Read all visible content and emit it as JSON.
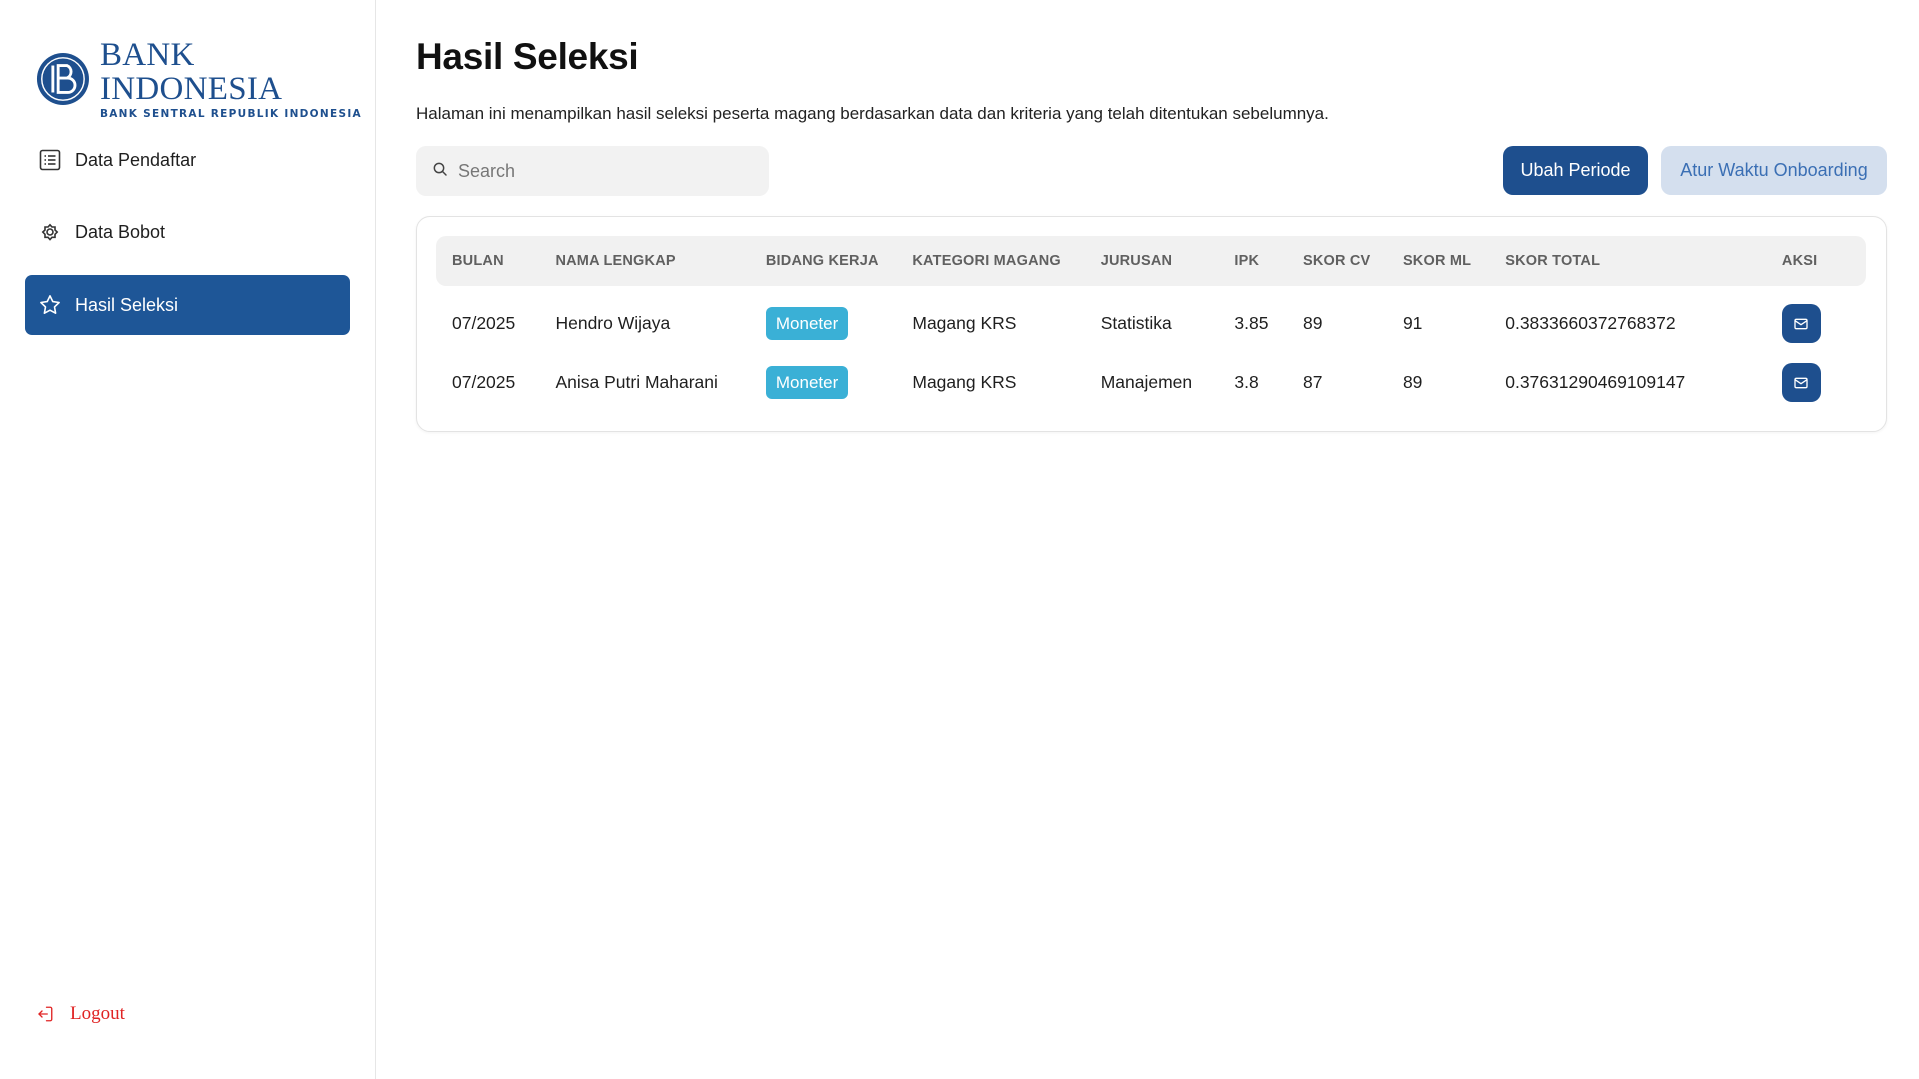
{
  "brand": {
    "title": "BANK INDONESIA",
    "subtitle": "BANK SENTRAL REPUBLIK INDONESIA",
    "color": "#1e4f8e"
  },
  "sidebar": {
    "items": [
      {
        "label": "Data Pendaftar",
        "icon": "list-icon",
        "active": false
      },
      {
        "label": "Data Bobot",
        "icon": "gear-icon",
        "active": false
      },
      {
        "label": "Hasil Seleksi",
        "icon": "star-icon",
        "active": true
      }
    ],
    "logout_label": "Logout"
  },
  "page": {
    "title": "Hasil Seleksi",
    "description": "Halaman ini menampilkan hasil seleksi peserta magang berdasarkan data dan kriteria yang telah ditentukan sebelumnya."
  },
  "search": {
    "placeholder": "Search",
    "value": ""
  },
  "actions": {
    "change_period": "Ubah Periode",
    "set_onboarding": "Atur Waktu Onboarding"
  },
  "table": {
    "columns": [
      "BULAN",
      "NAMA LENGKAP",
      "BIDANG KERJA",
      "KATEGORI MAGANG",
      "JURUSAN",
      "IPK",
      "SKOR CV",
      "SKOR ML",
      "SKOR TOTAL",
      "AKSI"
    ],
    "rows": [
      {
        "bulan": "07/2025",
        "nama": "Hendro Wijaya",
        "bidang": "Moneter",
        "kategori": "Magang KRS",
        "jurusan": "Statistika",
        "ipk": "3.85",
        "skor_cv": "89",
        "skor_ml": "91",
        "skor_total": "0.3833660372768372"
      },
      {
        "bulan": "07/2025",
        "nama": "Anisa Putri Maharani",
        "bidang": "Moneter",
        "kategori": "Magang KRS",
        "jurusan": "Manajemen",
        "ipk": "3.8",
        "skor_cv": "87",
        "skor_ml": "89",
        "skor_total": "0.37631290469109147"
      }
    ]
  },
  "colors": {
    "primary": "#1e4f8e",
    "secondary_bg": "#d4dfee",
    "badge": "#3ab0d6",
    "logout": "#e02424"
  }
}
